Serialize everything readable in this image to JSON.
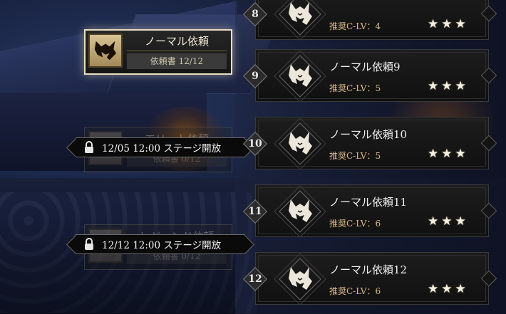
{
  "categories": [
    {
      "title": "ノーマル依頼",
      "sub": "依頼書 12/12",
      "state": "active"
    },
    {
      "title": "エリート依頼",
      "sub": "依頼書 0/12",
      "state": "locked",
      "lock_text": "12/05 12:00 ステージ開放"
    },
    {
      "title": "レジェンド依頼",
      "sub": "依頼書 0/12",
      "state": "locked",
      "lock_text": "12/12 12:00 ステージ開放"
    }
  ],
  "quests": [
    {
      "num": "8",
      "name": "",
      "lv": "推奨C-LV：4",
      "stars": 3
    },
    {
      "num": "9",
      "name": "ノーマル依頼9",
      "lv": "推奨C-LV：5",
      "stars": 3
    },
    {
      "num": "10",
      "name": "ノーマル依頼10",
      "lv": "推奨C-LV：5",
      "stars": 3
    },
    {
      "num": "11",
      "name": "ノーマル依頼11",
      "lv": "推奨C-LV：6",
      "stars": 3
    },
    {
      "num": "12",
      "name": "ノーマル依頼12",
      "lv": "推奨C-LV：6",
      "stars": 3
    }
  ],
  "star_glyph": "★",
  "icons": {
    "emblem": "wolf-head-icon",
    "lock": "padlock-icon",
    "star": "star-icon"
  },
  "colors": {
    "level_text": "#d9b98a",
    "active_border": "#e8dcc0",
    "star": "#f3f0e6"
  }
}
